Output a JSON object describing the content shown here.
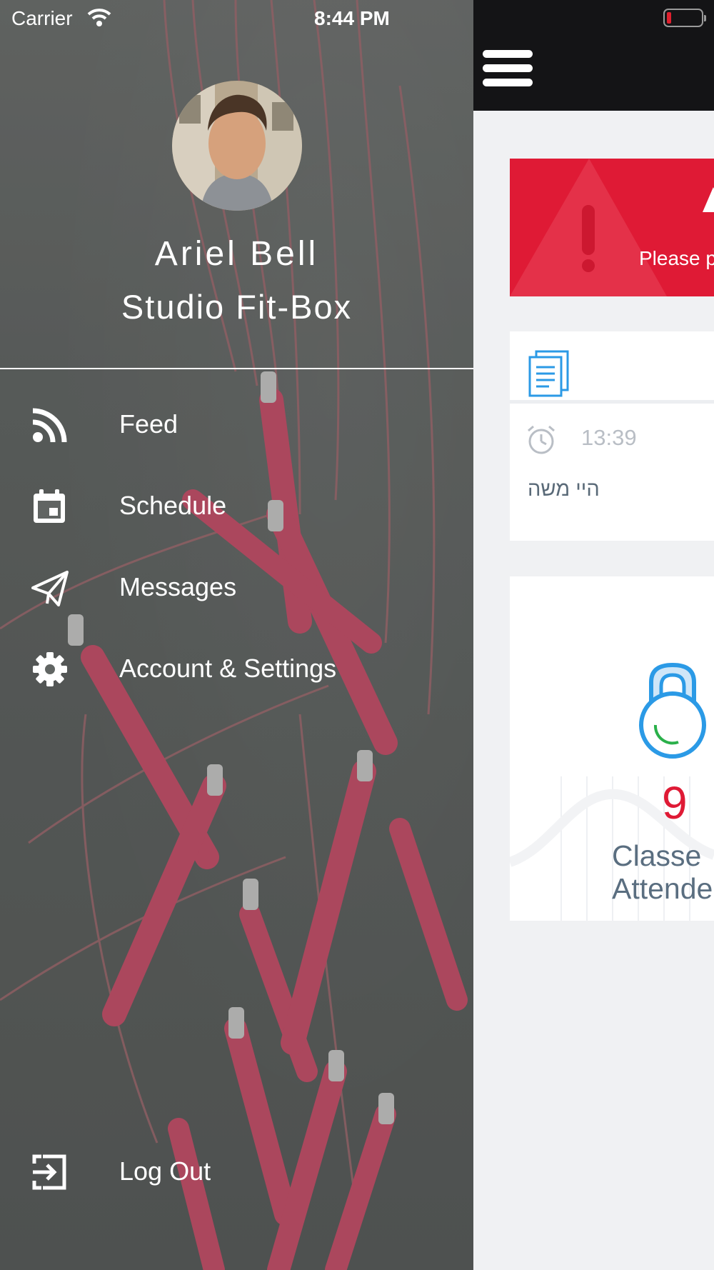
{
  "status_bar": {
    "carrier": "Carrier",
    "time": "8:44 PM",
    "wifi_icon": "wifi-icon",
    "battery_icon": "battery-low-icon"
  },
  "drawer": {
    "profile": {
      "name": "Ariel Bell",
      "studio": "Studio Fit-Box"
    },
    "menu": [
      {
        "label": "Feed",
        "icon": "rss-icon"
      },
      {
        "label": "Schedule",
        "icon": "calendar-icon"
      },
      {
        "label": "Messages",
        "icon": "paper-plane-icon"
      },
      {
        "label": "Account & Settings",
        "icon": "gear-icon"
      }
    ],
    "logout": {
      "label": "Log Out",
      "icon": "logout-icon"
    }
  },
  "main": {
    "menu_icon": "hamburger-icon",
    "alert": {
      "text": "Please p"
    },
    "post": {
      "time": "13:39",
      "text": "היי משה"
    },
    "stat": {
      "value": "9",
      "label_line1": "Classe",
      "label_line2": "Attende"
    }
  },
  "colors": {
    "accent_red": "#df1a35",
    "topbar": "#141416",
    "icon_blue": "#2b9ae6"
  }
}
